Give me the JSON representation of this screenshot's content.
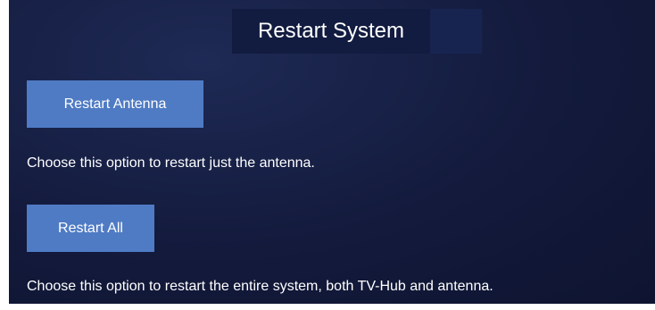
{
  "dialog": {
    "title": "Restart System"
  },
  "options": {
    "antenna": {
      "button_label": "Restart Antenna",
      "description": "Choose this option to restart just the antenna."
    },
    "all": {
      "button_label": "Restart All",
      "description": "Choose this option to restart the entire system, both TV-Hub and antenna."
    }
  },
  "colors": {
    "panel_background": "#131a3c",
    "button_background": "#4f7bc4",
    "text": "#ffffff"
  }
}
